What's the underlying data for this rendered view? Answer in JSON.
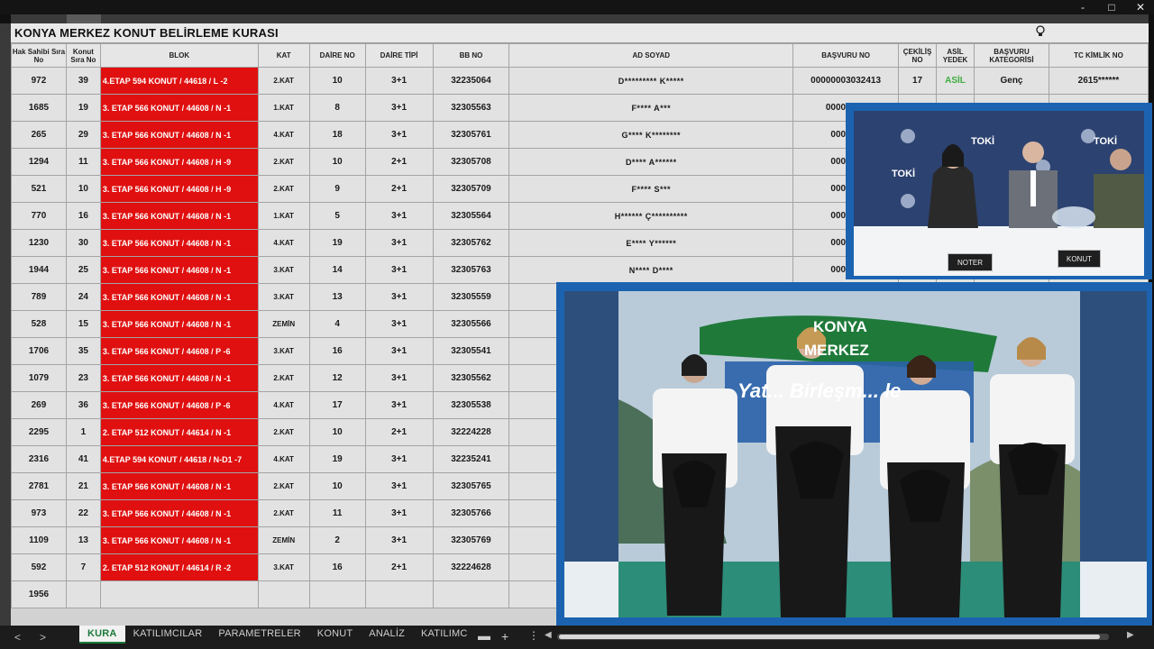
{
  "window": {
    "controls": [
      "-",
      "□",
      "✕"
    ]
  },
  "sheet": {
    "title": "KONYA MERKEZ KONUT BELİRLEME KURASI",
    "headers": {
      "hak_sahibi": "Hak Sahibi Sıra No",
      "konut_sira": "Konut Sıra No",
      "blok": "BLOK",
      "kat": "KAT",
      "daire_no": "DAİRE NO",
      "daire_tipi": "DAİRE TİPİ",
      "bb_no": "BB NO",
      "ad_soyad": "AD SOYAD",
      "basvuru_no": "BAŞVURU NO",
      "cekilis_no": "ÇEKİLİŞ NO",
      "asil_yedek": "ASİL YEDEK",
      "basvuru_kategorisi": "BAŞVURU KATEGORİSİ",
      "tc_kimlik_no": "TC KİMLİK NO"
    },
    "rows": [
      {
        "hak": "972",
        "konut": "39",
        "blok": "4.ETAP 594 KONUT / 44618 / L -2",
        "kat": "2.KAT",
        "daire": "10",
        "tip": "3+1",
        "bb": "32235064",
        "ad": "D********* K*****",
        "basvuru": "00000003032413",
        "cekilis": "17",
        "asil": "ASİL",
        "kategori": "Genç",
        "tc": "2615******"
      },
      {
        "hak": "1685",
        "konut": "19",
        "blok": "3. ETAP 566 KONUT / 44608 / N -1",
        "kat": "1.KAT",
        "daire": "8",
        "tip": "3+1",
        "bb": "32305563",
        "ad": "F**** A***",
        "basvuru": "00000000",
        "cekilis": "",
        "asil": "",
        "kategori": "",
        "tc": ""
      },
      {
        "hak": "265",
        "konut": "29",
        "blok": "3. ETAP 566 KONUT / 44608 / N -1",
        "kat": "4.KAT",
        "daire": "18",
        "tip": "3+1",
        "bb": "32305761",
        "ad": "G**** K********",
        "basvuru": "000000",
        "cekilis": "",
        "asil": "",
        "kategori": "",
        "tc": ""
      },
      {
        "hak": "1294",
        "konut": "11",
        "blok": "3. ETAP 566 KONUT / 44608 / H -9",
        "kat": "2.KAT",
        "daire": "10",
        "tip": "2+1",
        "bb": "32305708",
        "ad": "D**** A******",
        "basvuru": "000000",
        "cekilis": "",
        "asil": "",
        "kategori": "",
        "tc": ""
      },
      {
        "hak": "521",
        "konut": "10",
        "blok": "3. ETAP 566 KONUT / 44608 / H -9",
        "kat": "2.KAT",
        "daire": "9",
        "tip": "2+1",
        "bb": "32305709",
        "ad": "F**** S***",
        "basvuru": "000000",
        "cekilis": "",
        "asil": "",
        "kategori": "",
        "tc": ""
      },
      {
        "hak": "770",
        "konut": "16",
        "blok": "3. ETAP 566 KONUT / 44608 / N -1",
        "kat": "1.KAT",
        "daire": "5",
        "tip": "3+1",
        "bb": "32305564",
        "ad": "H****** Ç**********",
        "basvuru": "000000",
        "cekilis": "",
        "asil": "",
        "kategori": "",
        "tc": ""
      },
      {
        "hak": "1230",
        "konut": "30",
        "blok": "3. ETAP 566 KONUT / 44608 / N -1",
        "kat": "4.KAT",
        "daire": "19",
        "tip": "3+1",
        "bb": "32305762",
        "ad": "E**** Y******",
        "basvuru": "000000",
        "cekilis": "",
        "asil": "",
        "kategori": "",
        "tc": ""
      },
      {
        "hak": "1944",
        "konut": "25",
        "blok": "3. ETAP 566 KONUT / 44608 / N -1",
        "kat": "3.KAT",
        "daire": "14",
        "tip": "3+1",
        "bb": "32305763",
        "ad": "N**** D****",
        "basvuru": "000000",
        "cekilis": "",
        "asil": "",
        "kategori": "",
        "tc": ""
      },
      {
        "hak": "789",
        "konut": "24",
        "blok": "3. ETAP 566 KONUT / 44608 / N -1",
        "kat": "3.KAT",
        "daire": "13",
        "tip": "3+1",
        "bb": "32305559",
        "ad": "",
        "basvuru": "",
        "cekilis": "",
        "asil": "",
        "kategori": "",
        "tc": ""
      },
      {
        "hak": "528",
        "konut": "15",
        "blok": "3. ETAP 566 KONUT / 44608 / N -1",
        "kat": "ZEMİN",
        "daire": "4",
        "tip": "3+1",
        "bb": "32305566",
        "ad": "",
        "basvuru": "",
        "cekilis": "",
        "asil": "",
        "kategori": "",
        "tc": ""
      },
      {
        "hak": "1706",
        "konut": "35",
        "blok": "3. ETAP 566 KONUT / 44608 / P -6",
        "kat": "3.KAT",
        "daire": "16",
        "tip": "3+1",
        "bb": "32305541",
        "ad": "",
        "basvuru": "",
        "cekilis": "",
        "asil": "",
        "kategori": "",
        "tc": ""
      },
      {
        "hak": "1079",
        "konut": "23",
        "blok": "3. ETAP 566 KONUT / 44608 / N -1",
        "kat": "2.KAT",
        "daire": "12",
        "tip": "3+1",
        "bb": "32305562",
        "ad": "",
        "basvuru": "",
        "cekilis": "",
        "asil": "",
        "kategori": "",
        "tc": ""
      },
      {
        "hak": "269",
        "konut": "36",
        "blok": "3. ETAP 566 KONUT / 44608 / P -6",
        "kat": "4.KAT",
        "daire": "17",
        "tip": "3+1",
        "bb": "32305538",
        "ad": "",
        "basvuru": "",
        "cekilis": "",
        "asil": "",
        "kategori": "",
        "tc": ""
      },
      {
        "hak": "2295",
        "konut": "1",
        "blok": "2. ETAP 512 KONUT / 44614 / N -1",
        "kat": "2.KAT",
        "daire": "10",
        "tip": "2+1",
        "bb": "32224228",
        "ad": "",
        "basvuru": "",
        "cekilis": "",
        "asil": "",
        "kategori": "",
        "tc": ""
      },
      {
        "hak": "2316",
        "konut": "41",
        "blok": "4.ETAP 594 KONUT / 44618 / N-D1 -7",
        "kat": "4.KAT",
        "daire": "19",
        "tip": "3+1",
        "bb": "32235241",
        "ad": "",
        "basvuru": "",
        "cekilis": "",
        "asil": "",
        "kategori": "",
        "tc": ""
      },
      {
        "hak": "2781",
        "konut": "21",
        "blok": "3. ETAP 566 KONUT / 44608 / N -1",
        "kat": "2.KAT",
        "daire": "10",
        "tip": "3+1",
        "bb": "32305765",
        "ad": "",
        "basvuru": "",
        "cekilis": "",
        "asil": "",
        "kategori": "",
        "tc": ""
      },
      {
        "hak": "973",
        "konut": "22",
        "blok": "3. ETAP 566 KONUT / 44608 / N -1",
        "kat": "2.KAT",
        "daire": "11",
        "tip": "3+1",
        "bb": "32305766",
        "ad": "",
        "basvuru": "",
        "cekilis": "",
        "asil": "",
        "kategori": "",
        "tc": ""
      },
      {
        "hak": "1109",
        "konut": "13",
        "blok": "3. ETAP 566 KONUT / 44608 / N -1",
        "kat": "ZEMİN",
        "daire": "2",
        "tip": "3+1",
        "bb": "32305769",
        "ad": "",
        "basvuru": "",
        "cekilis": "",
        "asil": "",
        "kategori": "",
        "tc": ""
      },
      {
        "hak": "592",
        "konut": "7",
        "blok": "2. ETAP 512 KONUT / 44614 / R -2",
        "kat": "3.KAT",
        "daire": "16",
        "tip": "2+1",
        "bb": "32224628",
        "ad": "",
        "basvuru": "",
        "cekilis": "",
        "asil": "",
        "kategori": "",
        "tc": ""
      },
      {
        "hak": "1956",
        "konut": "",
        "blok": "",
        "kat": "",
        "daire": "",
        "tip": "",
        "bb": "",
        "ad": "",
        "basvuru": "",
        "cekilis": "",
        "asil": "",
        "kategori": "",
        "tc": ""
      }
    ]
  },
  "tabs": {
    "nav_prev": "<",
    "nav_next": ">",
    "items": [
      "KURA",
      "KATILIMCILAR",
      "PARAMETRELER",
      "KONUT",
      "ANALİZ",
      "KATILIMC"
    ],
    "active": "KURA",
    "add": "+",
    "more": "⋮",
    "minus": "▬",
    "scroll_left": "◀",
    "scroll_right": "▶"
  },
  "video_small": {
    "logos": [
      "TOKİ",
      "TOKİ",
      "TOKİ"
    ],
    "label_left": "NOTER",
    "label_right": "KONUT"
  },
  "video_large": {
    "banner_line1": "KONYA",
    "banner_line2": "MERKEZ",
    "banner_line3": "Yat... Birleşm... le"
  },
  "colors": {
    "blok_red": "#e01010",
    "asil_green": "#3fae3f",
    "video_frame_blue": "#1b63b0",
    "active_tab_green": "#1a7a3a"
  }
}
